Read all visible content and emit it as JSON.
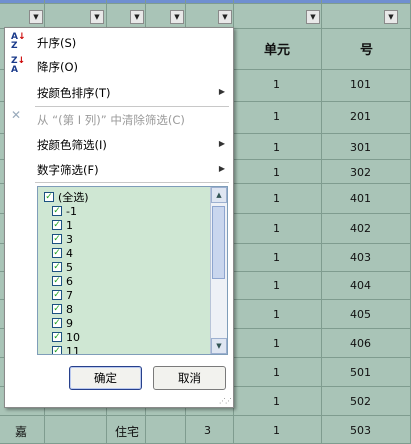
{
  "filter_menu": {
    "sort_asc": "升序(S)",
    "sort_desc": "降序(O)",
    "sort_by_color": "按颜色排序(T)",
    "clear_filter": "从 “(第 I 列)” 中清除筛选(C)",
    "filter_by_color": "按颜色筛选(I)",
    "number_filters": "数字筛选(F)",
    "select_all": "(全选)",
    "values": [
      "-1",
      "1",
      "3",
      "4",
      "5",
      "6",
      "7",
      "8",
      "9",
      "10",
      "11"
    ],
    "ok": "确定",
    "cancel": "取消",
    "icons": {
      "sort_asc": "sort-ascending-icon",
      "sort_desc": "sort-descending-icon",
      "clear": "clear-filter-icon"
    }
  },
  "sheet": {
    "headers": {
      "unit": "单元",
      "number": "号"
    },
    "unit_values": [
      "1",
      "1",
      "1",
      "1",
      "1",
      "1",
      "1",
      "1",
      "1",
      "1",
      "1",
      "1",
      "1"
    ],
    "number_values": [
      "101",
      "201",
      "301",
      "302",
      "401",
      "402",
      "403",
      "404",
      "405",
      "406",
      "501",
      "502",
      "503"
    ],
    "bottom_row": {
      "a": "嘉",
      "c": "住宅",
      "e": "3"
    }
  }
}
